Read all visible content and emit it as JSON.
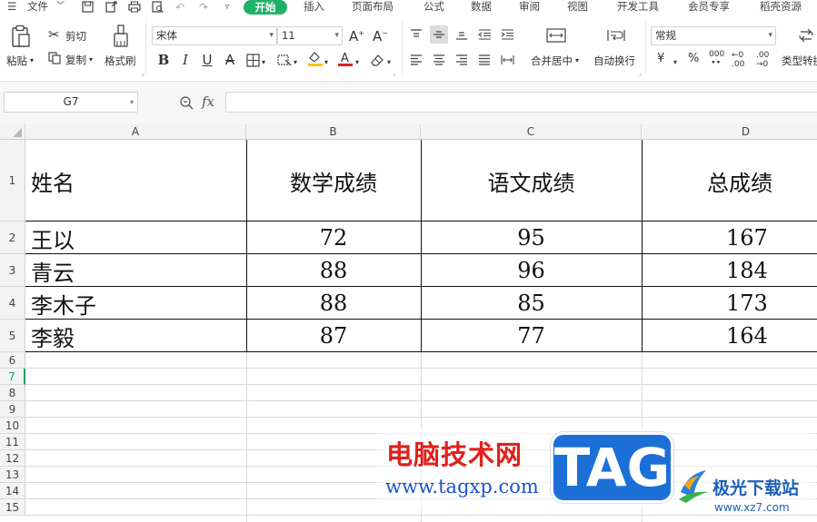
{
  "menubar": {
    "file_label": "文件",
    "tabs": [
      "开始",
      "插入",
      "页面布局",
      "公式",
      "数据",
      "审阅",
      "视图",
      "开发工具",
      "会员专享",
      "稻壳资源"
    ]
  },
  "ribbon": {
    "paste_label": "粘贴",
    "cut_label": "剪切",
    "copy_label": "复制",
    "format_painter_label": "格式刷",
    "font_name": "宋体",
    "font_size": "11",
    "merge_center_label": "合并居中",
    "wrap_text_label": "自动换行",
    "number_format": "常规",
    "currency_symbol": "¥",
    "percent_symbol": "%",
    "thousands_symbol": "000",
    "type_convert_label": "类型转换",
    "font_color": "#e02020",
    "fill_color": "#f5c400"
  },
  "formula_bar": {
    "name_box": "G7",
    "fx_label": "fx",
    "formula": ""
  },
  "sheet": {
    "columns": [
      "A",
      "B",
      "C",
      "D"
    ],
    "row_numbers": [
      "1",
      "2",
      "3",
      "4",
      "5",
      "6",
      "7",
      "8",
      "9",
      "10",
      "11",
      "12",
      "13",
      "14",
      "15"
    ],
    "active_row": "7",
    "header": [
      "姓名",
      "数学成绩",
      "语文成绩",
      "总成绩"
    ],
    "rows": [
      [
        "王以",
        "72",
        "95",
        "167"
      ],
      [
        "青云",
        "88",
        "96",
        "184"
      ],
      [
        "李木子",
        "88",
        "85",
        "173"
      ],
      [
        "李毅",
        "87",
        "77",
        "164"
      ]
    ]
  },
  "watermark": {
    "title": "电脑技术网",
    "url": "www.tagxp.com",
    "tag": "TAG",
    "site_name": "极光下载站",
    "site_url": "www.xz7.com"
  },
  "colors": {
    "accent": "#20b168",
    "watermark_red": "#e0201a",
    "watermark_blue": "#1d6fd8"
  }
}
